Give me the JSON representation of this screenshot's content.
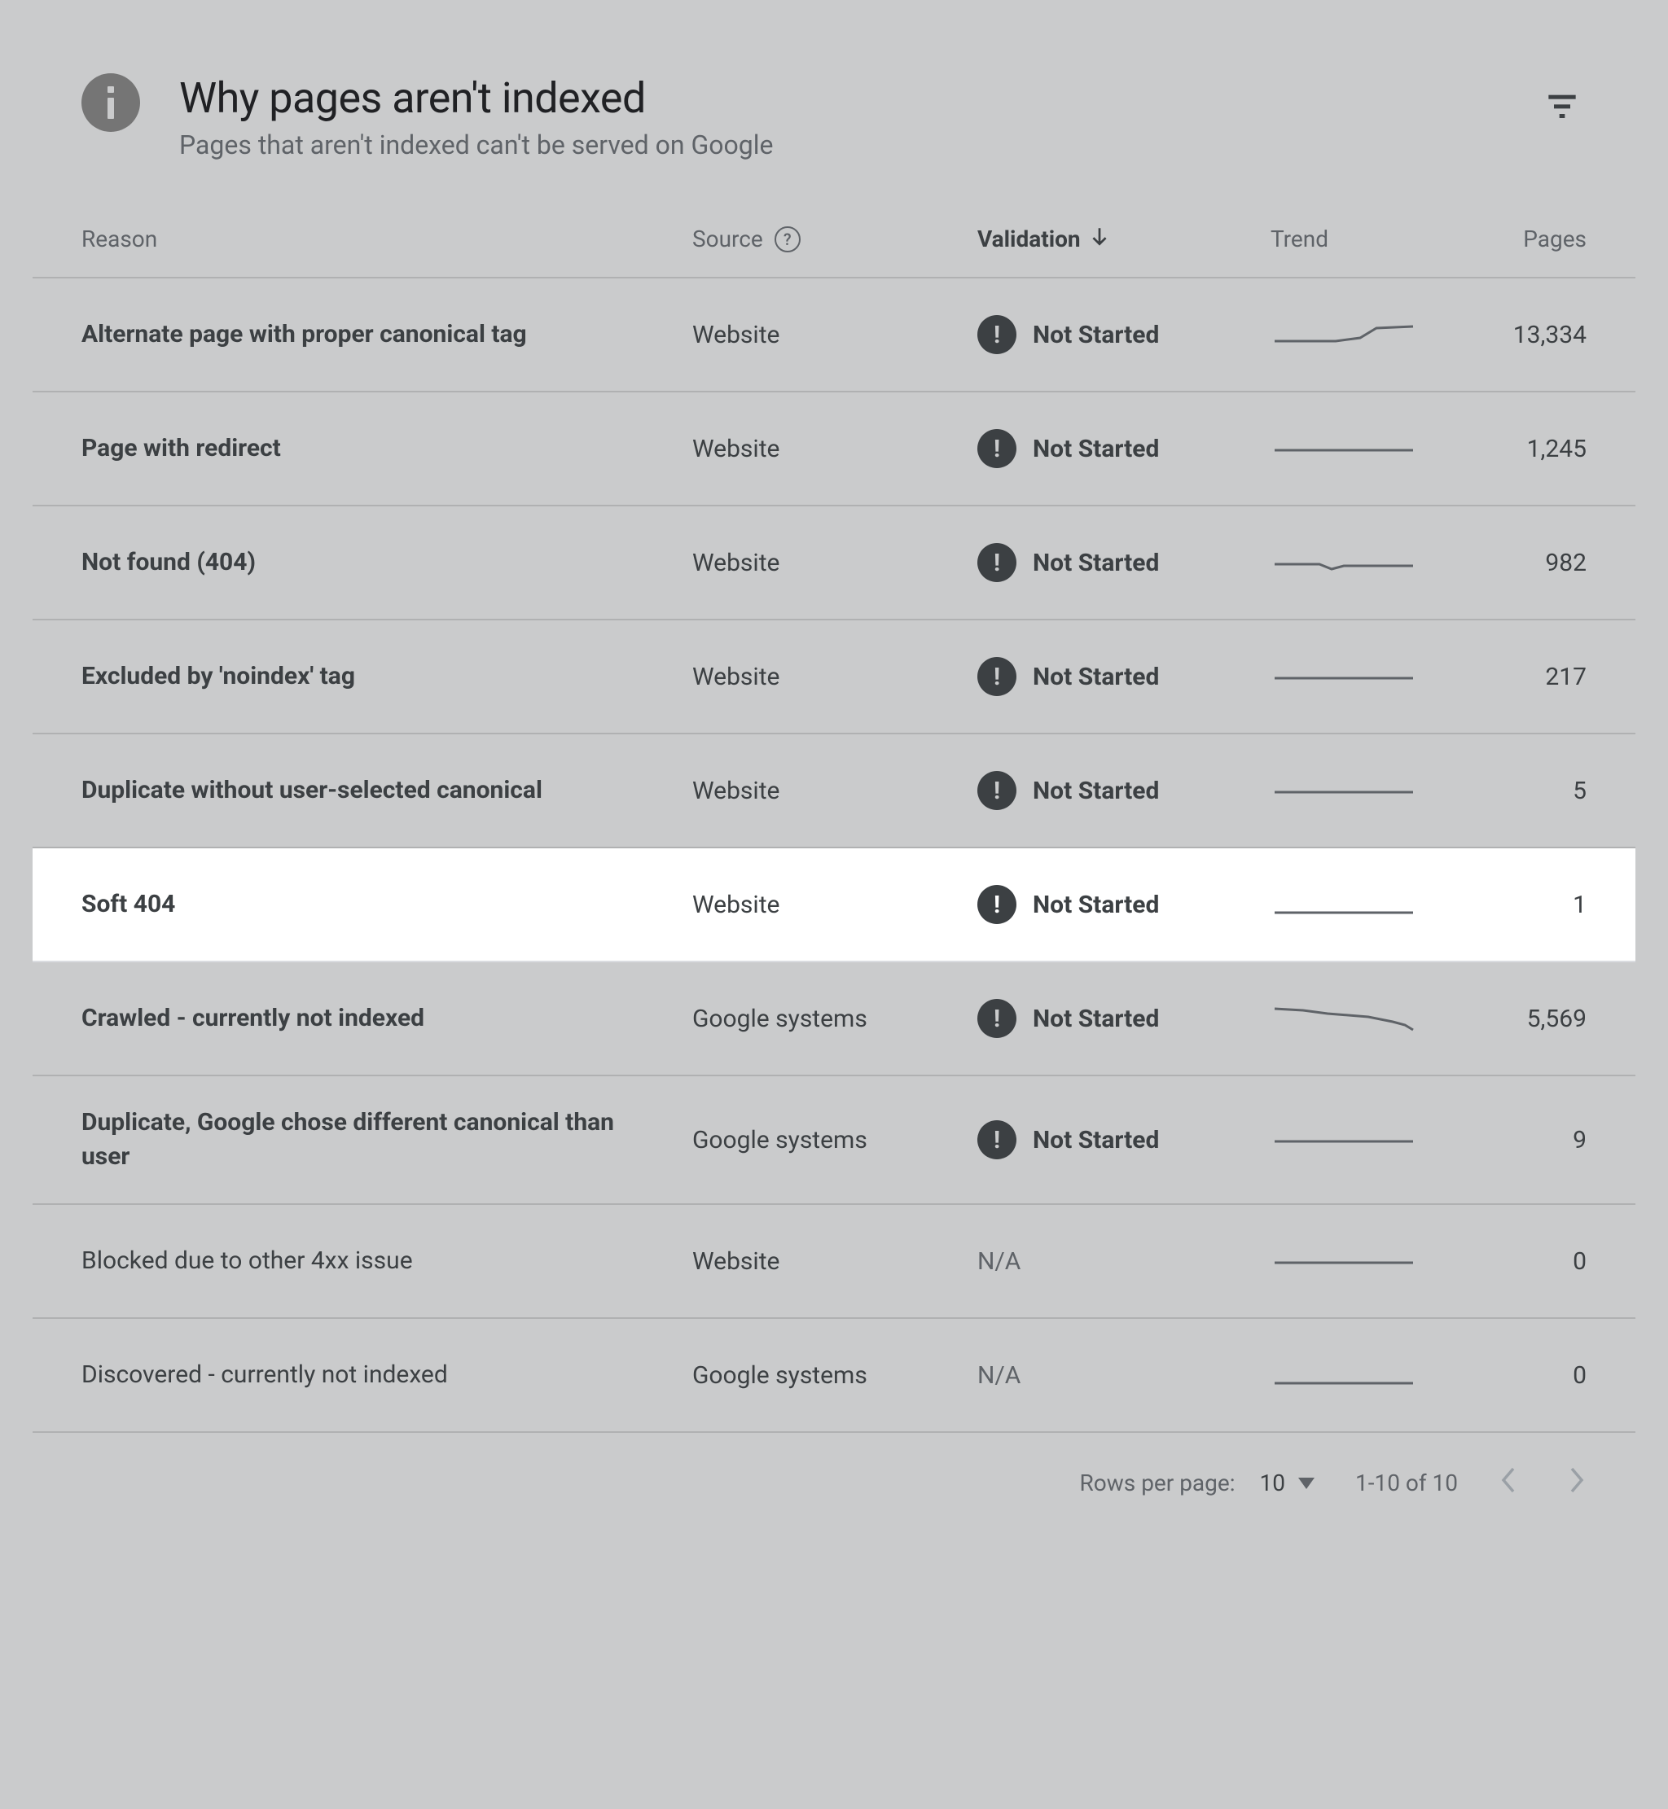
{
  "header": {
    "title": "Why pages aren't indexed",
    "subtitle": "Pages that aren't indexed can't be served on Google"
  },
  "columns": {
    "reason": "Reason",
    "source": "Source",
    "validation": "Validation",
    "trend": "Trend",
    "pages": "Pages"
  },
  "rows": [
    {
      "reason": "Alternate page with proper canonical tag",
      "source": "Website",
      "validation": "Not Started",
      "pages": "13,334",
      "bold": true,
      "highlighted": false,
      "trend": "rise"
    },
    {
      "reason": "Page with redirect",
      "source": "Website",
      "validation": "Not Started",
      "pages": "1,245",
      "bold": true,
      "highlighted": false,
      "trend": "flat"
    },
    {
      "reason": "Not found (404)",
      "source": "Website",
      "validation": "Not Started",
      "pages": "982",
      "bold": true,
      "highlighted": false,
      "trend": "dip"
    },
    {
      "reason": "Excluded by 'noindex' tag",
      "source": "Website",
      "validation": "Not Started",
      "pages": "217",
      "bold": true,
      "highlighted": false,
      "trend": "flat"
    },
    {
      "reason": "Duplicate without user-selected canonical",
      "source": "Website",
      "validation": "Not Started",
      "pages": "5",
      "bold": true,
      "highlighted": false,
      "trend": "flat"
    },
    {
      "reason": "Soft 404",
      "source": "Website",
      "validation": "Not Started",
      "pages": "1",
      "bold": true,
      "highlighted": true,
      "trend": "flat-low"
    },
    {
      "reason": "Crawled - currently not indexed",
      "source": "Google systems",
      "validation": "Not Started",
      "pages": "5,569",
      "bold": true,
      "highlighted": false,
      "trend": "decline"
    },
    {
      "reason": "Duplicate, Google chose different canonical than user",
      "source": "Google systems",
      "validation": "Not Started",
      "pages": "9",
      "bold": true,
      "highlighted": false,
      "trend": "flat"
    },
    {
      "reason": "Blocked due to other 4xx issue",
      "source": "Website",
      "validation": "N/A",
      "pages": "0",
      "bold": false,
      "highlighted": false,
      "trend": "flat"
    },
    {
      "reason": "Discovered - currently not indexed",
      "source": "Google systems",
      "validation": "N/A",
      "pages": "0",
      "bold": false,
      "highlighted": false,
      "trend": "flat-low"
    }
  ],
  "pagination": {
    "rowsPerPageLabel": "Rows per page:",
    "rowsPerPageValue": "10",
    "pageInfo": "1-10 of 10"
  }
}
